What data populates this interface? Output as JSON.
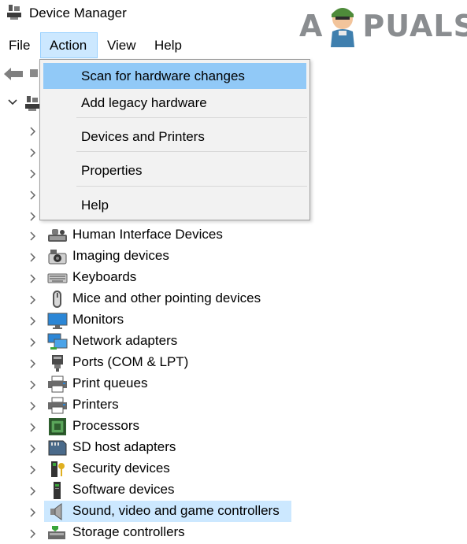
{
  "window": {
    "title": "Device Manager"
  },
  "watermark": {
    "left": "A",
    "right": "PUALS"
  },
  "menubar": {
    "items": [
      "File",
      "Action",
      "View",
      "Help"
    ],
    "active": "Action"
  },
  "action_menu": {
    "items": [
      {
        "label": "Scan for hardware changes",
        "highlighted": true
      },
      {
        "label": "Add legacy hardware"
      },
      {
        "label": "Devices and Printers"
      },
      {
        "label": "Properties"
      },
      {
        "label": "Help"
      }
    ]
  },
  "tree": {
    "categories": [
      {
        "label": "Human Interface Devices",
        "icon": "hid-icon"
      },
      {
        "label": "Imaging devices",
        "icon": "camera-icon"
      },
      {
        "label": "Keyboards",
        "icon": "keyboard-icon"
      },
      {
        "label": "Mice and other pointing devices",
        "icon": "mouse-icon"
      },
      {
        "label": "Monitors",
        "icon": "monitor-icon"
      },
      {
        "label": "Network adapters",
        "icon": "network-adapter-icon"
      },
      {
        "label": "Ports (COM & LPT)",
        "icon": "port-icon"
      },
      {
        "label": "Print queues",
        "icon": "printer-icon"
      },
      {
        "label": "Printers",
        "icon": "printer-icon"
      },
      {
        "label": "Processors",
        "icon": "processor-icon"
      },
      {
        "label": "SD host adapters",
        "icon": "sd-card-icon"
      },
      {
        "label": "Security devices",
        "icon": "security-key-icon"
      },
      {
        "label": "Software devices",
        "icon": "software-device-icon"
      },
      {
        "label": "Sound, video and game controllers",
        "icon": "speaker-icon",
        "selected": true
      },
      {
        "label": "Storage controllers",
        "icon": "storage-controller-icon"
      }
    ]
  },
  "colors": {
    "selection": "#cce8ff",
    "menu_hover": "#91c9f7",
    "menu_bg": "#f2f2f2"
  }
}
